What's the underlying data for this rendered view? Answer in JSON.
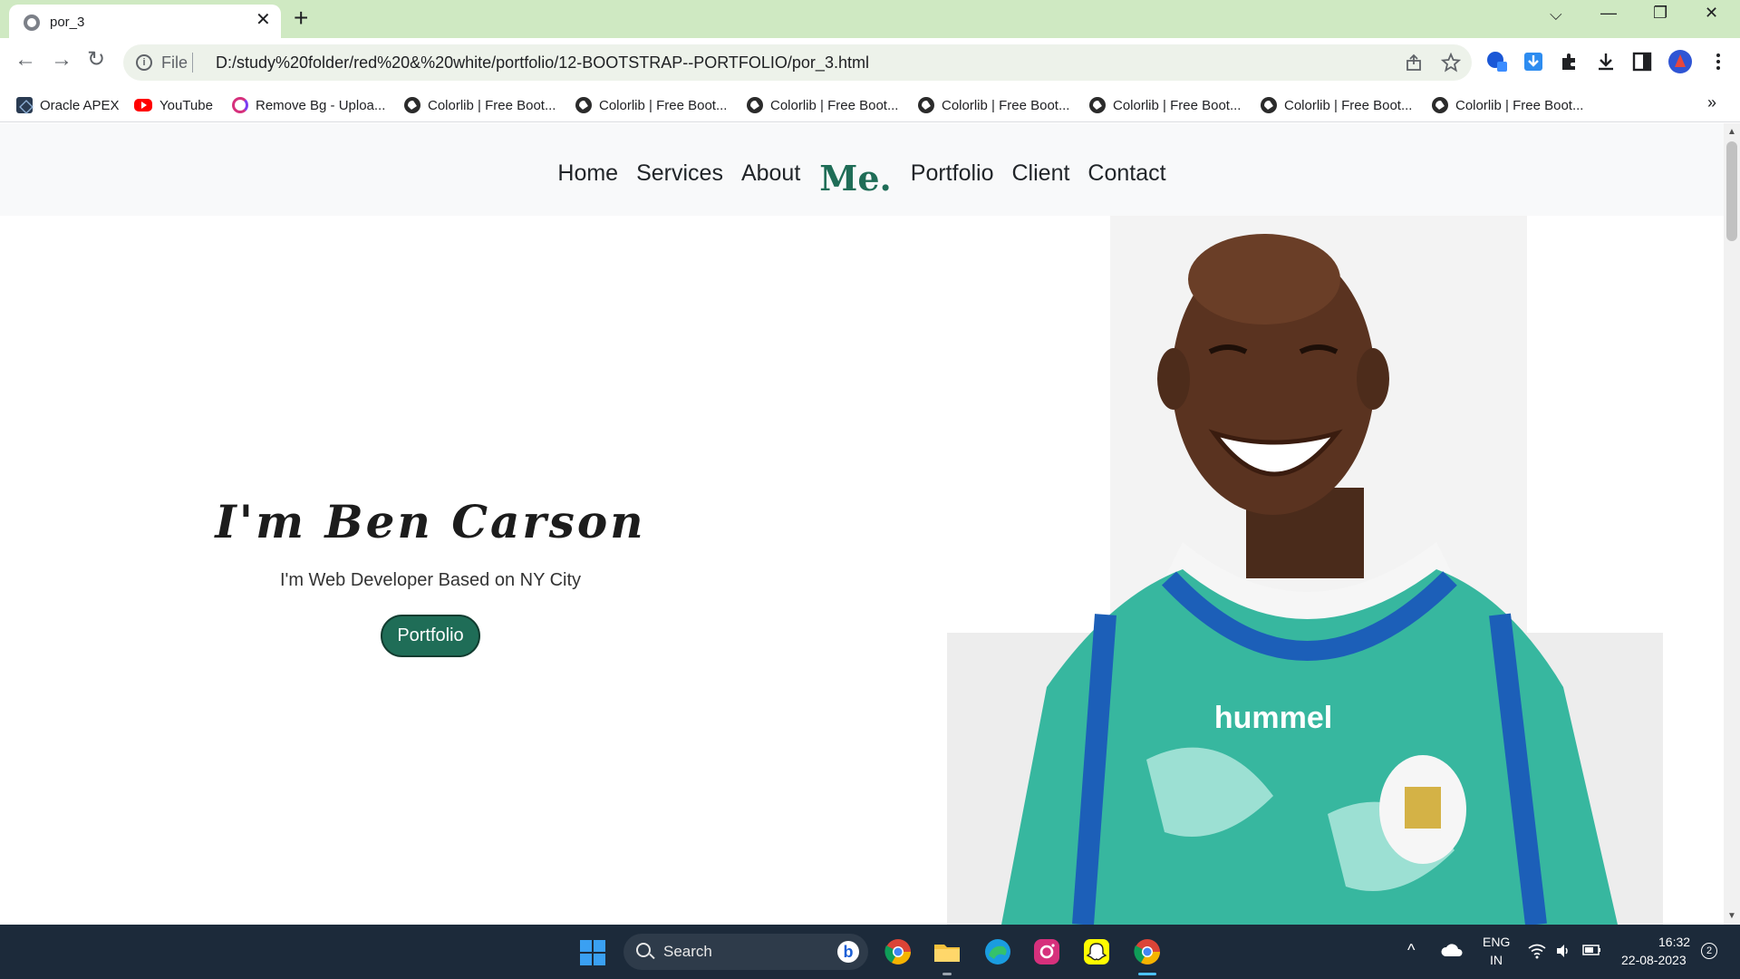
{
  "browser": {
    "tab_title": "por_3",
    "tab_close_glyph": "✕",
    "new_tab_glyph": "+",
    "window_controls": [
      "⌵",
      "—",
      "❐",
      "✕"
    ],
    "omnibox": {
      "scheme_label": "File",
      "url": "D:/study%20folder/red%20&%20white/portfolio/12-BOOTSTRAP--PORTFOLIO/por_3.html"
    },
    "nav_glyphs": {
      "back": "←",
      "forward": "→",
      "reload": "↻"
    },
    "toolbar_icons": [
      "share-icon",
      "star-icon",
      "extension-a-icon",
      "download-arrow-icon",
      "puzzle-icon",
      "download-icon",
      "side-panel-icon",
      "profile-avatar-icon",
      "menu-icon"
    ],
    "accent_color": "#cfe9c2"
  },
  "bookmarks": [
    {
      "label": "Oracle APEX",
      "icon": "apex-icon"
    },
    {
      "label": "YouTube",
      "icon": "youtube-icon"
    },
    {
      "label": "Remove Bg - Uploa...",
      "icon": "removebg-icon"
    },
    {
      "label": "Colorlib | Free Boot...",
      "icon": "globe-icon"
    },
    {
      "label": "Colorlib | Free Boot...",
      "icon": "globe-icon"
    },
    {
      "label": "Colorlib | Free Boot...",
      "icon": "globe-icon"
    },
    {
      "label": "Colorlib | Free Boot...",
      "icon": "globe-icon"
    },
    {
      "label": "Colorlib | Free Boot...",
      "icon": "globe-icon"
    },
    {
      "label": "Colorlib | Free Boot...",
      "icon": "globe-icon"
    },
    {
      "label": "Colorlib | Free Boot...",
      "icon": "globe-icon"
    }
  ],
  "bookmarks_more": "»",
  "site": {
    "nav_left": [
      "Home",
      "Services",
      "About"
    ],
    "brand": "Me",
    "brand_dot": ".",
    "nav_right": [
      "Portfolio",
      "Client",
      "Contact"
    ],
    "hero": {
      "title": "I'm Ben Carson",
      "subtitle": "I'm Web Developer Based on NY City",
      "button": "Portfolio"
    },
    "brand_color": "#1f6d57",
    "jersey_text": "hummel"
  },
  "taskbar": {
    "search_label": "Search",
    "apps": [
      "chrome-icon",
      "file-explorer-icon",
      "edge-icon",
      "instagram-icon",
      "snapchat-icon",
      "chrome-active-icon"
    ],
    "language": [
      "ENG",
      "IN"
    ],
    "time": "16:32",
    "date": "22-08-2023",
    "notification_count": "2"
  }
}
